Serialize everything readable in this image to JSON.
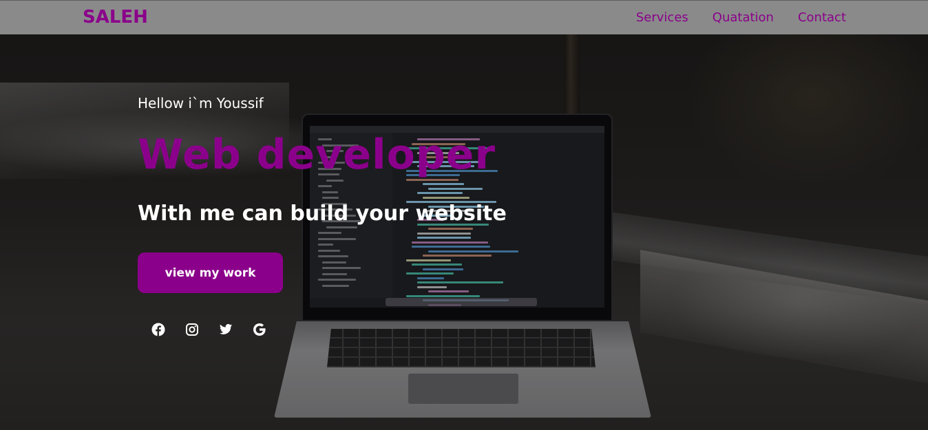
{
  "navbar": {
    "brand": "SALEH",
    "links": [
      {
        "label": "Services"
      },
      {
        "label": "Quatation"
      },
      {
        "label": "Contact"
      }
    ]
  },
  "hero": {
    "greeting": "Hellow i`m Youssif",
    "headline": "Web developer",
    "subheadline": "With me can build your website",
    "cta_label": "view my work"
  },
  "socials": [
    {
      "icon": "facebook-icon"
    },
    {
      "icon": "instagram-icon"
    },
    {
      "icon": "twitter-icon"
    },
    {
      "icon": "google-icon"
    }
  ],
  "colors": {
    "accent": "#8b008b",
    "navbar_bg": "#8a8a8a",
    "text_light": "#ffffff"
  }
}
